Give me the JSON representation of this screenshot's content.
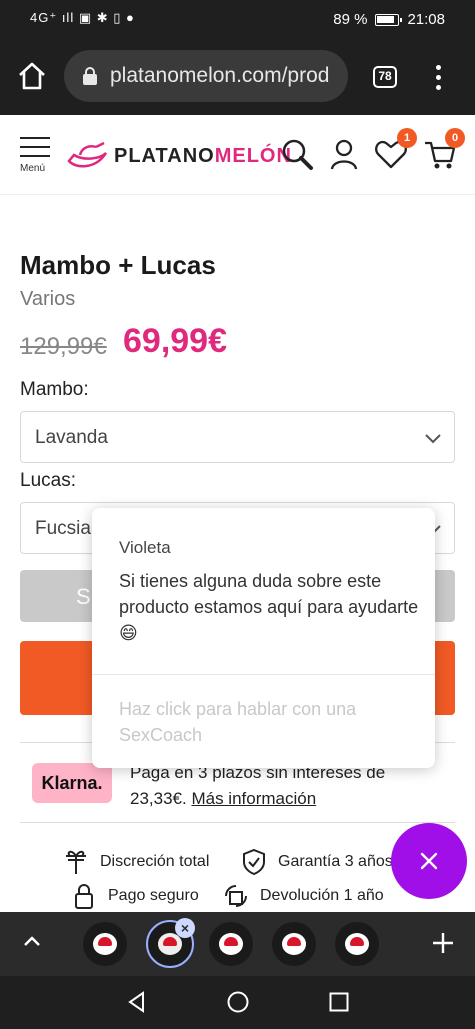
{
  "status_bar": {
    "signal": "4G⁺ ıll",
    "battery": "89 %",
    "time": "21:08"
  },
  "browser": {
    "url": "platanomelon.com/prod",
    "tab_count": "78"
  },
  "site_header": {
    "menu_label": "Menú",
    "logo_pre": "PLATANO",
    "logo_post": "MELÓN",
    "wishlist_count": "1",
    "cart_count": "0"
  },
  "product": {
    "title": "Mambo + Lucas",
    "brand": "Varios",
    "old_price": "129,99€",
    "price": "69,99€"
  },
  "options": [
    {
      "label": "Mambo:",
      "value": "Lavanda"
    },
    {
      "label": "Lucas:",
      "value": "Fucsia"
    }
  ],
  "buttons": {
    "grey_label": "Si"
  },
  "klarna": {
    "logo": "Klarna.",
    "text": "Paga en 3 plazos sin intereses de 23,33€.",
    "link": "Más información"
  },
  "features": [
    {
      "label": "Discreción total",
      "icon": "gift-icon"
    },
    {
      "label": "Garantía 3 años",
      "icon": "shield-check-icon"
    },
    {
      "label": "Pago seguro",
      "icon": "lock-icon"
    },
    {
      "label": "Devolución 1 año",
      "icon": "return-box-icon"
    }
  ],
  "chat": {
    "agent": "Violeta",
    "message": "Si tienes alguna duda sobre este producto estamos aquí para ayudarte 😄",
    "placeholder": "Haz click para hablar con una SexCoach"
  },
  "colors": {
    "brand_pink": "#e0297e",
    "orange": "#f15a24",
    "chat_fab": "#a10fe8",
    "klarna_pink": "#ffb3c7"
  }
}
